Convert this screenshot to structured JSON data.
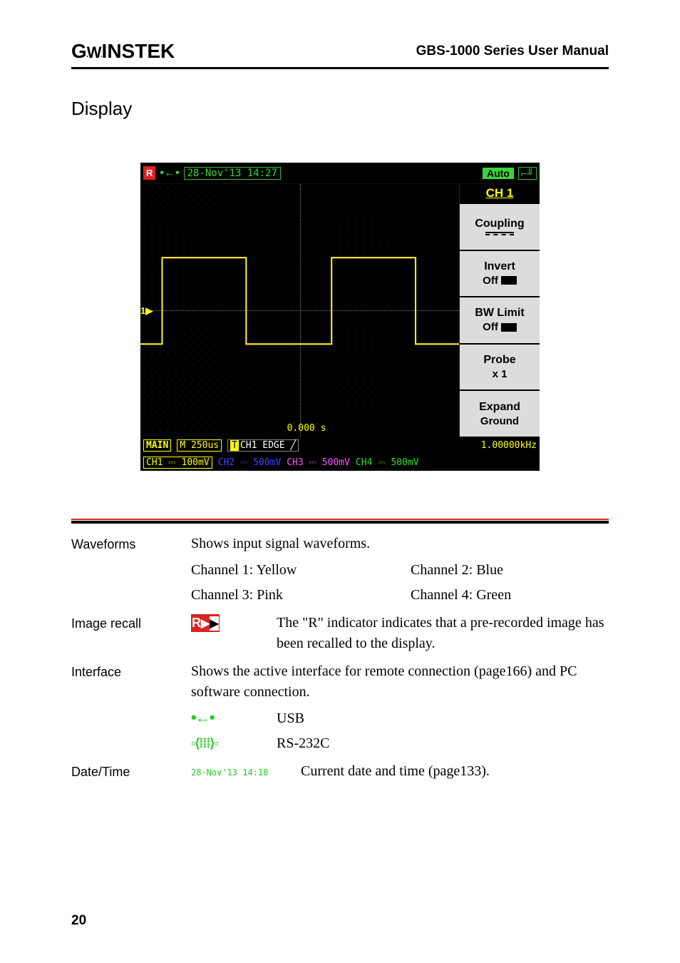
{
  "header": {
    "logo_text": "GWINSTEK",
    "manual_title": "GBS-1000 Series User Manual"
  },
  "section_heading": "Display",
  "oscilloscope": {
    "r_badge": "R",
    "date_time": "28-Nov'13 14:27",
    "auto": "Auto",
    "side_menu_title": "CH 1",
    "menu": {
      "coupling": "Coupling",
      "invert": "Invert",
      "invert_state": "Off",
      "bw_limit": "BW Limit",
      "bw_state": "Off",
      "probe": "Probe",
      "probe_val": "x 1",
      "expand": "Expand",
      "expand_val": "Ground"
    },
    "ch1_marker": "1▶",
    "zero_s": "0.000 s",
    "bottom": {
      "main": "MAIN",
      "timebase": "M 250us",
      "trigger": "CH1  EDGE",
      "slope": "╱",
      "freq": "1.00000kHz",
      "ch1": "CH1 ⎓ 100mV",
      "ch2": "CH2 ⎓ 500mV",
      "ch3": "CH3 ⎓ 500mV",
      "ch4": "CH4 ⎓ 500mV"
    }
  },
  "table": {
    "waveforms": {
      "label": "Waveforms",
      "desc": "Shows input signal waveforms.",
      "ch1": "Channel 1: Yellow",
      "ch2": "Channel 2: Blue",
      "ch3": "Channel 3: Pink",
      "ch4": "Channel 4: Green"
    },
    "image_recall": {
      "label": "Image recall",
      "r_text": "R▶▶",
      "desc": "The \"R\" indicator indicates that a pre-recorded image has been recalled to the display."
    },
    "interface": {
      "label": "Interface",
      "desc": "Shows the active interface for remote connection (page166) and PC software connection.",
      "usb_label": "USB",
      "rs232_label": "RS-232C"
    },
    "datetime": {
      "label": "Date/Time",
      "sample": "28-Nov'13 14:18",
      "desc": "Current date and time (page133)."
    }
  },
  "page_number": "20"
}
